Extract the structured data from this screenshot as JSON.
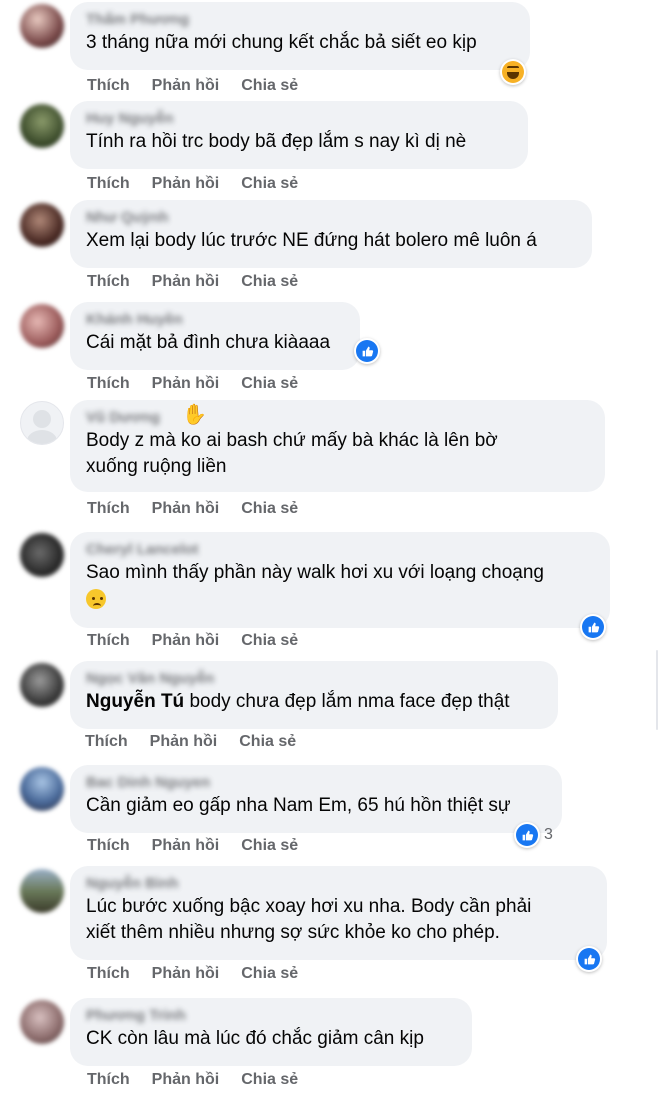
{
  "actions": {
    "like": "Thích",
    "reply": "Phản hồi",
    "share": "Chia sẻ"
  },
  "comments": [
    {
      "name": "Thẩm Phương",
      "text": "3 tháng nữa mới chung kết chắc bả siết eo kịp",
      "reaction": "haha-icon"
    },
    {
      "name": "Huy Nguyễn",
      "text": "Tính ra hồi trc body bã đẹp lắm s nay kì dị nè"
    },
    {
      "name": "Như Quỳnh",
      "text": "Xem lại body lúc trước NE đứng hát bolero mê luôn á"
    },
    {
      "name": "Khánh Huyền",
      "text": "Cái mặt bả đình chưa kiàaaa",
      "reaction": "like-icon"
    },
    {
      "name": "Vũ Dương",
      "text_lines": [
        "Body z mà ko ai bash chứ mấy bà khác là lên bờ",
        "xuống ruộng liền"
      ]
    },
    {
      "name": "Cheryl Lancelot",
      "text": "Sao mình thấy phần này walk hơi xu với loạng choạng",
      "reaction": "like-icon"
    },
    {
      "name": "Ngọc Vân Nguyễn",
      "mention": "Nguyễn Tú",
      "text": "body chưa đẹp lắm nma face đẹp thật"
    },
    {
      "name": "Bac Dinh Nguyen",
      "text": "Cần giảm eo gấp nha Nam Em, 65 hú hồn thiệt sự",
      "reaction": "like-icon",
      "reaction_count": "3"
    },
    {
      "name": "Nguyễn Bình",
      "text_lines": [
        "Lúc bước xuống bậc xoay hơi xu nha. Body cần phải",
        "xiết thêm nhiều nhưng sợ sức khỏe ko cho phép."
      ],
      "reaction": "like-icon"
    },
    {
      "name": "Phương Trinh",
      "text": "CK còn lâu mà lúc đó chắc giảm cân kịp"
    }
  ]
}
